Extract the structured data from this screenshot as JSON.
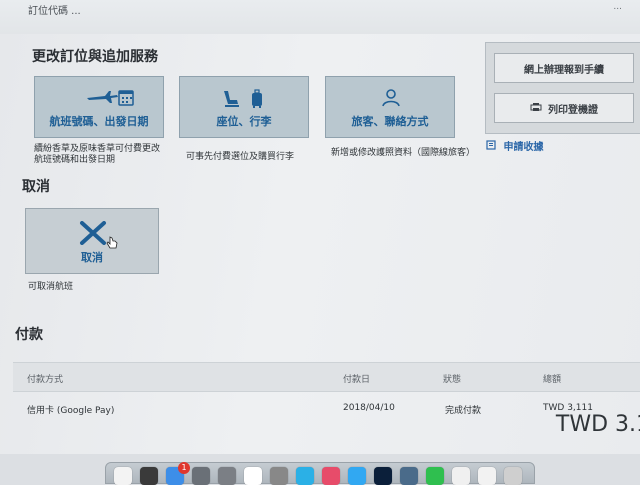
{
  "top": {
    "left_text": "訂位代碼 ...",
    "right_text": "..."
  },
  "change_section": {
    "title": "更改訂位與追加服務",
    "tiles": [
      {
        "label": "航班號碼、出發日期",
        "desc": "續紛香草及原味香草可付費更改航班號碼和出發日期",
        "icon": "plane-calendar-icon"
      },
      {
        "label": "座位、行李",
        "desc": "可事先付費選位及購買行李",
        "icon": "seat-luggage-icon"
      },
      {
        "label": "旅客、聯絡方式",
        "desc": "新增或修改護照資料（國際線旅客）",
        "icon": "person-icon"
      }
    ]
  },
  "side_panel": {
    "web_checkin": "網上辦理報到手續",
    "print_itinerary": "列印登機證",
    "apply_receipt": "申請收據"
  },
  "cancel_section": {
    "title": "取消",
    "tile_label": "取消",
    "desc": "可取消航班"
  },
  "payment_section": {
    "title": "付款",
    "headers": {
      "method": "付款方式",
      "date": "付款日",
      "status": "狀態",
      "amount": "總額"
    },
    "rows": [
      {
        "method": "信用卡 (Google Pay)",
        "date": "2018/04/10",
        "status": "完成付款",
        "amount": "TWD 3,111"
      }
    ],
    "total_partial": "TWD 3.1"
  },
  "dock": {
    "badge_count": "1"
  },
  "colors": {
    "accent": "#1f5f95",
    "tile_bg": "#b9c7cf",
    "link": "#2a66a8"
  }
}
